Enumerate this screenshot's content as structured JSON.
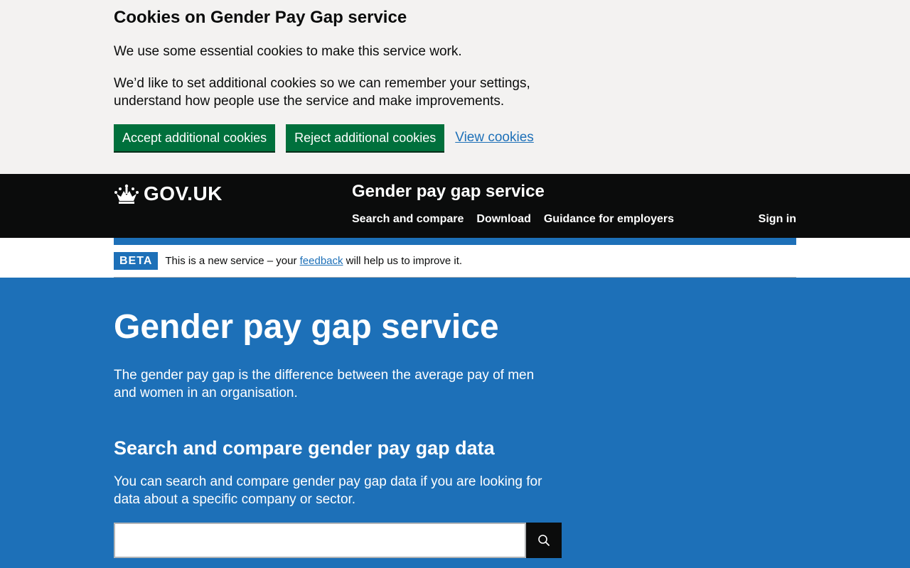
{
  "cookie_banner": {
    "title": "Cookies on Gender Pay Gap service",
    "paragraph_1": "We use some essential cookies to make this service work.",
    "paragraph_2": "We’d like to set additional cookies so we can remember your settings, understand how people use the service and make improvements.",
    "accept_label": "Accept additional cookies",
    "reject_label": "Reject additional cookies",
    "view_label": "View cookies"
  },
  "header": {
    "logo_text": "GOV.UK",
    "logo_icon": "crown-icon",
    "service_name": "Gender pay gap service",
    "nav": [
      {
        "label": "Search and compare"
      },
      {
        "label": "Download"
      },
      {
        "label": "Guidance for employers"
      }
    ],
    "sign_in_label": "Sign in"
  },
  "phase_banner": {
    "tag": "BETA",
    "text_before": "This is a new service – your ",
    "link_text": "feedback",
    "text_after": " will help us to improve it."
  },
  "main": {
    "title": "Gender pay gap service",
    "intro": "The gender pay gap is the difference between the average pay of men and women in an organisation.",
    "search_heading": "Search and compare gender pay gap data",
    "search_description": "You can search and compare gender pay gap data if you are looking for data about a specific company or sector.",
    "search_value": "",
    "search_icon": "search-icon"
  },
  "colors": {
    "brand_blue": "#1d70b8",
    "button_green": "#00703c",
    "header_black": "#0b0c0c",
    "cookie_bg": "#f3f2f1"
  }
}
